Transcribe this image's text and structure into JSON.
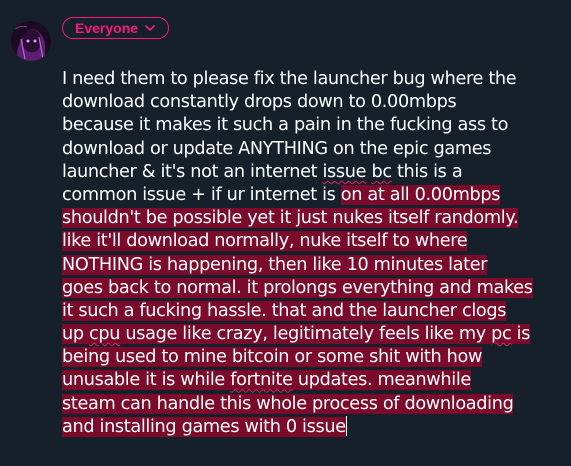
{
  "audience": {
    "label": "Everyone",
    "icon": "chevron-down-icon",
    "accent": "#f9187f"
  },
  "highlight_color": "#7c0b2b",
  "post": {
    "lines": [
      {
        "segments": [
          {
            "t": "I need them to please fix the launcher bug where the"
          }
        ]
      },
      {
        "segments": [
          {
            "t": "download constantly drops down to 0.00mbps"
          }
        ]
      },
      {
        "segments": [
          {
            "t": "because it makes it such a pain in the fucking ass to"
          }
        ]
      },
      {
        "segments": [
          {
            "t": "download or update ANYTHING on the epic games"
          }
        ]
      },
      {
        "segments": [
          {
            "t": "launcher & it's not an internet "
          },
          {
            "t": "issue",
            "sp": true
          },
          {
            "t": " "
          },
          {
            "t": "bc",
            "sp": true
          },
          {
            "t": " this is a"
          }
        ]
      },
      {
        "segments": [
          {
            "t": "common issue + if ur internet is "
          },
          {
            "t": "on at all 0.00mbps",
            "hl": true
          }
        ]
      },
      {
        "segments": [
          {
            "t": "shouldn't be possible yet it just nukes itself randomly.",
            "hl": true
          }
        ]
      },
      {
        "segments": [
          {
            "t": "like it'll download normally, nuke itself to where",
            "hl": true
          }
        ]
      },
      {
        "segments": [
          {
            "t": "NOTHING is happening, then like 10 minutes later",
            "hl": true
          }
        ]
      },
      {
        "segments": [
          {
            "t": "goes back to normal. it prolongs everything and makes",
            "hl": true
          }
        ]
      },
      {
        "segments": [
          {
            "t": "it such a fucking hassle. that and the launcher clogs",
            "hl": true
          }
        ]
      },
      {
        "segments": [
          {
            "t": "up ",
            "hl": true
          },
          {
            "t": "cpu",
            "hl": true,
            "sp": true
          },
          {
            "t": " usage like crazy, legitimately feels like my ",
            "hl": true
          },
          {
            "t": "pc",
            "hl": true,
            "sp": true
          },
          {
            "t": " is",
            "hl": true
          }
        ]
      },
      {
        "segments": [
          {
            "t": "being used to mine bitcoin or some shit with how",
            "hl": true
          }
        ]
      },
      {
        "segments": [
          {
            "t": "unusable it is while ",
            "hl": true
          },
          {
            "t": "fortnite",
            "hl": true,
            "sp": true
          },
          {
            "t": " updates. meanwhile",
            "hl": true
          }
        ]
      },
      {
        "segments": [
          {
            "t": "steam can handle this whole process of downloading",
            "hl": true
          }
        ]
      },
      {
        "segments": [
          {
            "t": "and installing games with 0 issue",
            "hl": true
          }
        ],
        "caret": true
      }
    ]
  }
}
